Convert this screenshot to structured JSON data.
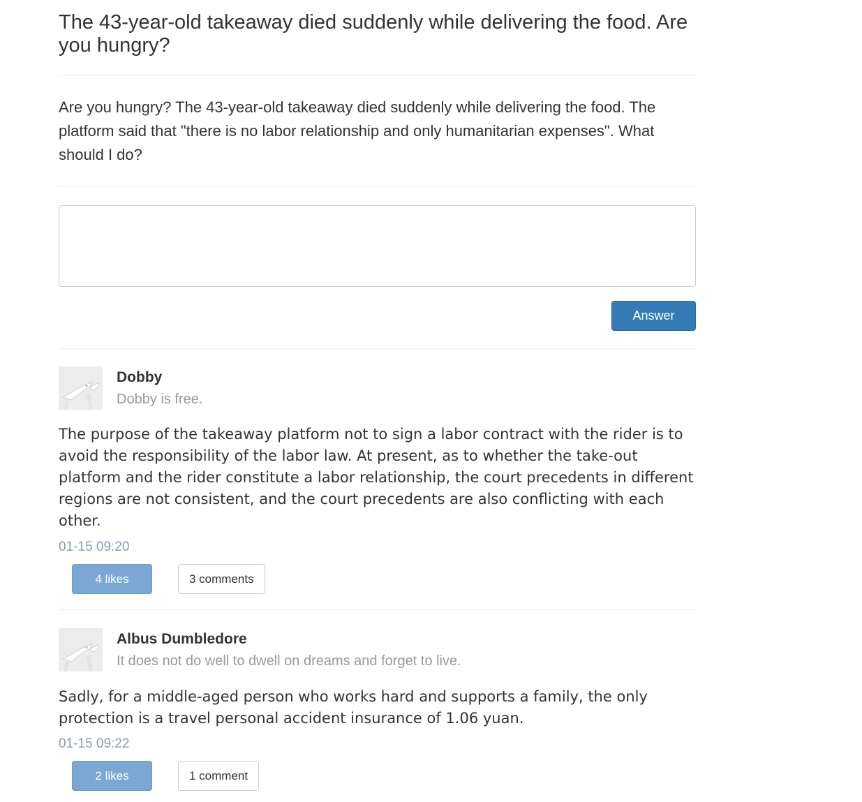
{
  "question": {
    "title": "The 43-year-old takeaway died suddenly while delivering the food. Are you hungry?",
    "description": "Are you hungry? The 43-year-old takeaway died suddenly while delivering the food. The platform said that \"there is no labor relationship and only humanitarian expenses\". What should I do?"
  },
  "answer_form": {
    "input_value": "",
    "button_label": "Answer"
  },
  "answers": [
    {
      "user_name": "Dobby",
      "user_bio": "Dobby is free.",
      "text": "The purpose of the takeaway platform not to sign a labor contract with the rider is to avoid the responsibility of the labor law. At present, as to whether the take-out platform and the rider constitute a labor relationship, the court precedents in different regions are not consistent, and the court precedents are also conflicting with each other.",
      "time": "01-15 09:20",
      "likes_label": "4 likes",
      "comments_label": "3 comments"
    },
    {
      "user_name": "Albus Dumbledore",
      "user_bio": "It does not do well to dwell on dreams and forget to live.",
      "text": "Sadly, for a middle-aged person who works hard and supports a family, the only protection is a travel personal accident insurance of 1.06 yuan.",
      "time": "01-15 09:22",
      "likes_label": "2 likes",
      "comments_label": "1 comment"
    }
  ],
  "colors": {
    "primary": "#337ab7",
    "like_button": "#7aa7d3",
    "muted_text": "#999999",
    "time_text": "#8a9bb0"
  }
}
